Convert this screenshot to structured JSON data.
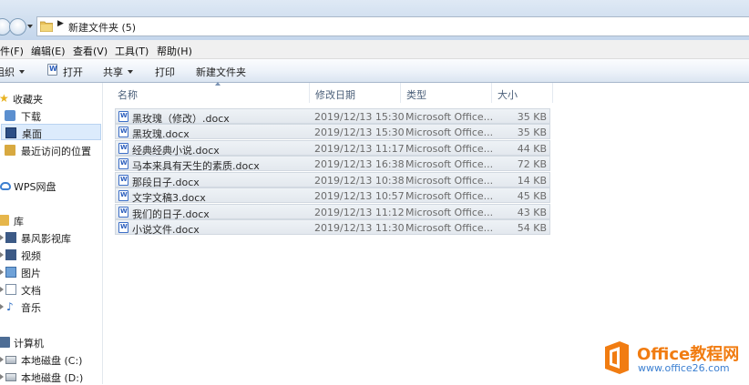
{
  "address": {
    "path": "新建文件夹 (5)"
  },
  "menu": [
    "件(F)",
    "编辑(E)",
    "查看(V)",
    "工具(T)",
    "帮助(H)"
  ],
  "toolbar": {
    "organize": "组织",
    "open": "打开",
    "share": "共享",
    "print": "打印",
    "new_folder": "新建文件夹"
  },
  "nav": {
    "favorites": "收藏夹",
    "downloads": "下载",
    "desktop": "桌面",
    "recent": "最近访问的位置",
    "wps": "WPS网盘",
    "libraries": "库",
    "video_lib": "暴风影视库",
    "videos": "视频",
    "pictures": "图片",
    "documents": "文档",
    "music": "音乐",
    "computer": "计算机",
    "drive_c": "本地磁盘 (C:)",
    "drive_d": "本地磁盘 (D:)"
  },
  "columns": {
    "name": "名称",
    "modified": "修改日期",
    "type": "类型",
    "size": "大小"
  },
  "files": [
    {
      "name": "黑玫瑰（修改）.docx",
      "modified": "2019/12/13 15:30",
      "type": "Microsoft Office...",
      "size": "35 KB"
    },
    {
      "name": "黑玫瑰.docx",
      "modified": "2019/12/13 15:30",
      "type": "Microsoft Office...",
      "size": "35 KB"
    },
    {
      "name": "经典经典小说.docx",
      "modified": "2019/12/13 11:17",
      "type": "Microsoft Office...",
      "size": "44 KB"
    },
    {
      "name": "马本来具有天生的素质.docx",
      "modified": "2019/12/13 16:38",
      "type": "Microsoft Office...",
      "size": "72 KB"
    },
    {
      "name": "那段日子.docx",
      "modified": "2019/12/13 10:38",
      "type": "Microsoft Office...",
      "size": "14 KB"
    },
    {
      "name": "文字文稿3.docx",
      "modified": "2019/12/13 10:57",
      "type": "Microsoft Office...",
      "size": "45 KB"
    },
    {
      "name": "我们的日子.docx",
      "modified": "2019/12/13 11:12",
      "type": "Microsoft Office...",
      "size": "43 KB"
    },
    {
      "name": "小说文件.docx",
      "modified": "2019/12/13 11:30",
      "type": "Microsoft Office...",
      "size": "54 KB"
    }
  ],
  "watermark": {
    "brand": "Office教程网",
    "url": "www.office26.com"
  },
  "colors": {
    "selection": "#dcebfc",
    "brand_orange": "#f17c11",
    "brand_blue": "#3b7fd1"
  }
}
